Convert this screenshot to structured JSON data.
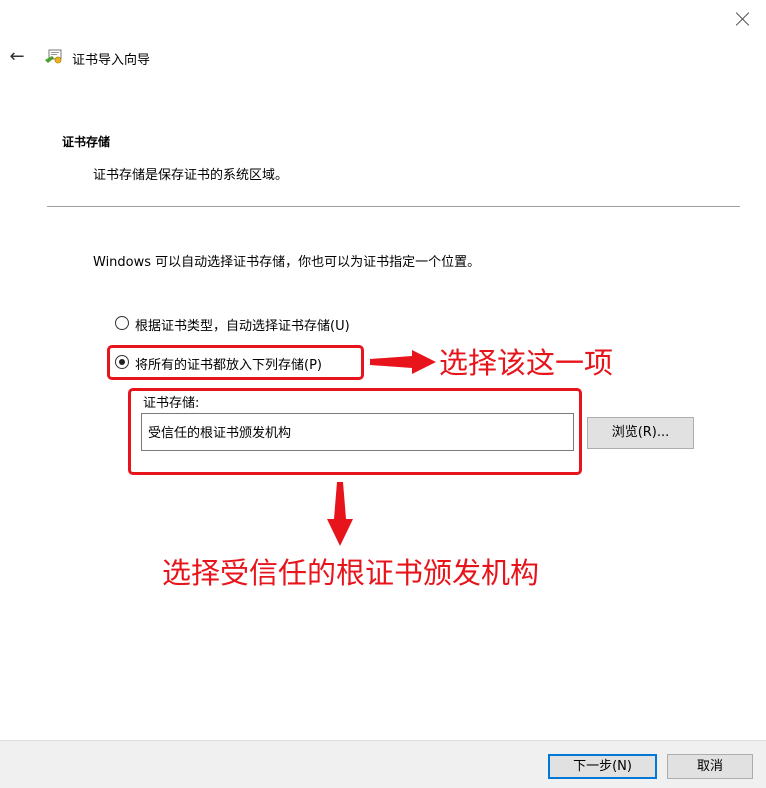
{
  "window": {
    "title": "证书导入向导"
  },
  "section": {
    "heading": "证书存储",
    "description": "证书存储是保存证书的系统区域。"
  },
  "intro": "Windows 可以自动选择证书存储，你也可以为证书指定一个位置。",
  "options": {
    "auto_label": "根据证书类型，自动选择证书存储(U)",
    "manual_label": "将所有的证书都放入下列存储(P)",
    "selected": "manual"
  },
  "store": {
    "label": "证书存储:",
    "value": "受信任的根证书颁发机构",
    "browse_label": "浏览(R)..."
  },
  "footer": {
    "next_label": "下一步(N)",
    "cancel_label": "取消"
  },
  "annotations": {
    "radio_note": "选择该这一项",
    "store_note": "选择受信任的根证书颁发机构"
  },
  "colors": {
    "annotation": "#e8141b",
    "accent": "#0078d7",
    "footer_bg": "#f0f0f0"
  }
}
